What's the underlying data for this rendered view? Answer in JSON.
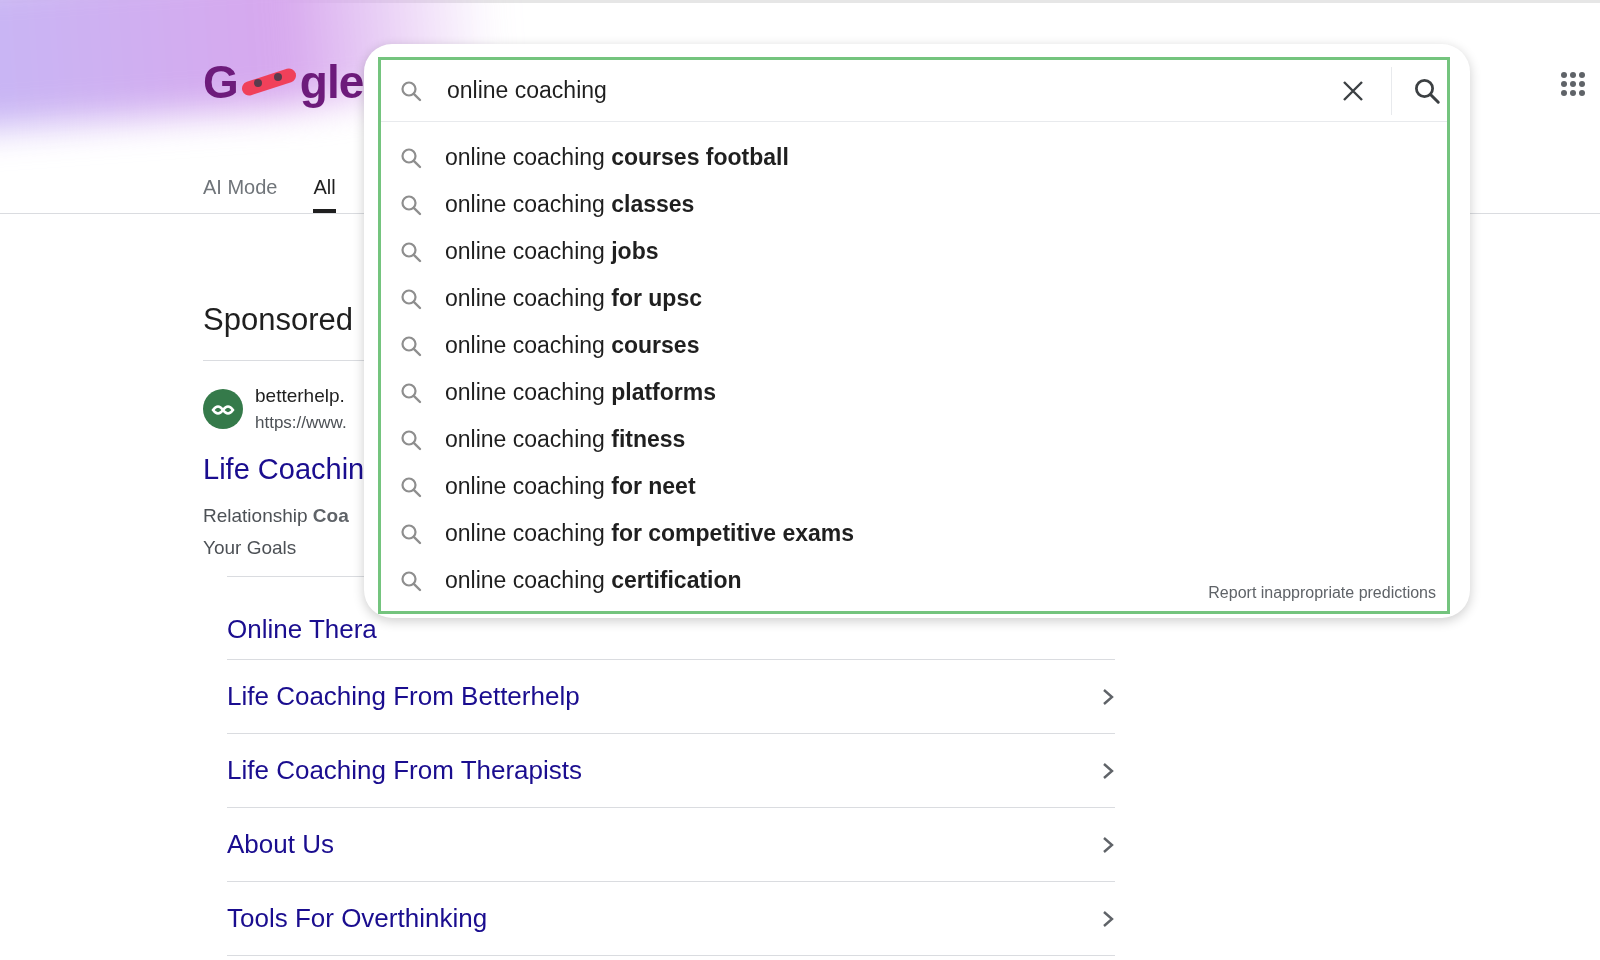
{
  "logo": {
    "start": "G",
    "end": "gle"
  },
  "tabs": [
    {
      "label": "AI Mode",
      "selected": false
    },
    {
      "label": "All",
      "selected": true
    }
  ],
  "search": {
    "value": "online coaching",
    "suggestions": [
      {
        "text": "online coaching **courses football**"
      },
      {
        "text": "online coaching **classes**"
      },
      {
        "text": "online coaching **jobs**"
      },
      {
        "text": "online coaching **for upsc**"
      },
      {
        "text": "online coaching **courses**"
      },
      {
        "text": "online coaching **platforms**"
      },
      {
        "text": "online coaching **fitness**"
      },
      {
        "text": "online coaching **for neet**"
      },
      {
        "text": "online coaching **for competitive exams**"
      },
      {
        "text": "online coaching **certification**"
      }
    ],
    "report_link": "Report inappropriate predictions"
  },
  "ad": {
    "label": "Sponsored",
    "site": "betterhelp.",
    "url": "https://www.",
    "title": "Life Coachin",
    "description": "Relationship **Coa**",
    "description_line_2": "Your Goals",
    "sitelinks": [
      {
        "text": "Online Thera",
        "chevron_visible": false
      },
      {
        "text": "Life Coaching From Betterhelp",
        "chevron_visible": true
      },
      {
        "text": "Life Coaching From Therapists",
        "chevron_visible": true
      },
      {
        "text": "About Us",
        "chevron_visible": true
      },
      {
        "text": "Tools For Overthinking",
        "chevron_visible": true
      }
    ]
  }
}
